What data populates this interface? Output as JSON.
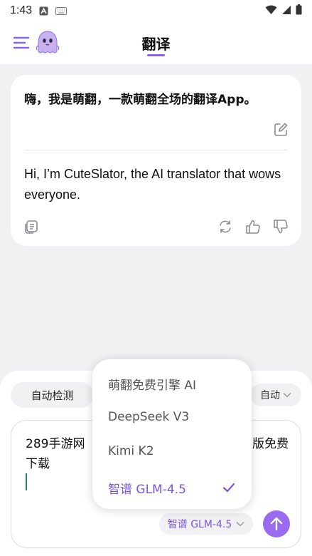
{
  "status_bar": {
    "time": "1:43"
  },
  "header": {
    "title": "翻译"
  },
  "translation_card": {
    "source_text": "嗨，我是萌翻，一款萌翻全场的翻译App。",
    "target_text": "Hi, I’m CuteSlator, the AI translator that wows everyone."
  },
  "bottom_panel": {
    "source_lang": "自动检测",
    "target_lang": "自动",
    "input_text_line1": "289手游网",
    "input_text_line1_end": "版免费",
    "input_text_line2": "下载",
    "model_chip_label": "智谱 GLM-4.5"
  },
  "model_dropdown": {
    "items": [
      {
        "label": "萌翻免费引擎 AI",
        "selected": false
      },
      {
        "label": "DeepSeek V3",
        "selected": false
      },
      {
        "label": "Kimi K2",
        "selected": false
      },
      {
        "label": "智谱 GLM-4.5",
        "selected": true
      }
    ]
  },
  "colors": {
    "accent": "#8a63e8",
    "background": "#f1f1f3",
    "send_button": "#9a6af0"
  },
  "icons": [
    "menu-icon",
    "ghost-mascot-icon",
    "edit-icon",
    "copy-icon",
    "refresh-icon",
    "thumbs-up-icon",
    "thumbs-down-icon",
    "chevron-down-icon",
    "arrow-up-icon",
    "check-icon",
    "wifi-icon",
    "signal-icon",
    "battery-icon"
  ]
}
